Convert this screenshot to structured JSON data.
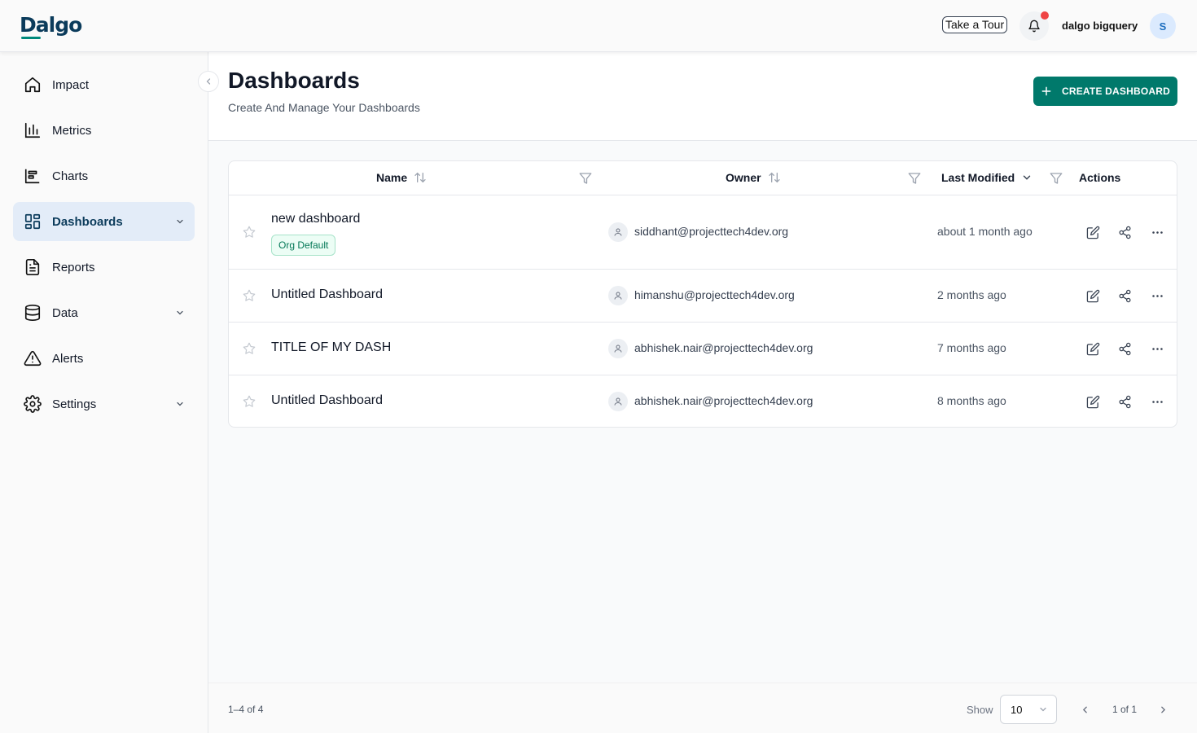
{
  "header": {
    "logo": "Dalgo",
    "tour_label": "Take a Tour",
    "org_name": "dalgo bigquery",
    "avatar_initial": "S"
  },
  "sidebar": {
    "items": [
      {
        "label": "Impact",
        "icon": "home-icon"
      },
      {
        "label": "Metrics",
        "icon": "bar-chart-icon"
      },
      {
        "label": "Charts",
        "icon": "chart-icon"
      },
      {
        "label": "Dashboards",
        "icon": "grid-icon",
        "active": true,
        "expandable": true
      },
      {
        "label": "Reports",
        "icon": "document-icon"
      },
      {
        "label": "Data",
        "icon": "database-icon",
        "expandable": true
      },
      {
        "label": "Alerts",
        "icon": "warning-icon"
      },
      {
        "label": "Settings",
        "icon": "gear-icon",
        "expandable": true
      }
    ]
  },
  "page": {
    "title": "Dashboards",
    "subtitle": "Create And Manage Your Dashboards",
    "create_label": "CREATE DASHBOARD"
  },
  "table": {
    "columns": {
      "name": "Name",
      "owner": "Owner",
      "modified": "Last Modified",
      "actions": "Actions"
    },
    "rows": [
      {
        "name": "new dashboard",
        "badge": "Org Default",
        "owner": "siddhant@projecttech4dev.org",
        "modified": "about 1 month ago"
      },
      {
        "name": "Untitled Dashboard",
        "owner": "himanshu@projecttech4dev.org",
        "modified": "2 months ago"
      },
      {
        "name": "TITLE OF MY DASH",
        "owner": "abhishek.nair@projecttech4dev.org",
        "modified": "7 months ago"
      },
      {
        "name": "Untitled Dashboard",
        "owner": "abhishek.nair@projecttech4dev.org",
        "modified": "8 months ago"
      }
    ]
  },
  "footer": {
    "range": "1–4 of 4",
    "show_label": "Show",
    "per_page": "10",
    "page_info": "1 of 1"
  },
  "colors": {
    "accent": "#00796b",
    "brand": "#0b3b5b",
    "active_bg": "#e3ecf8",
    "badge_text": "#047857"
  }
}
